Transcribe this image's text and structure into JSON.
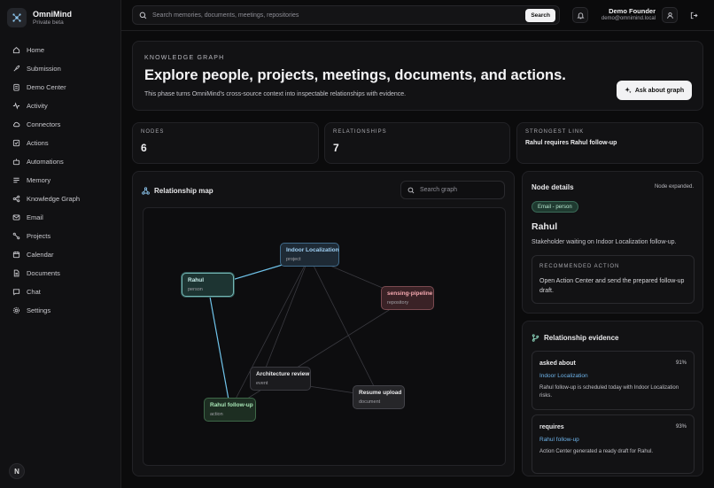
{
  "brand": {
    "name": "OmniMind",
    "subtitle": "Private beta",
    "avatar_initial": "N"
  },
  "nav": [
    {
      "label": "Home",
      "icon": "home-icon"
    },
    {
      "label": "Submission",
      "icon": "rocket-icon"
    },
    {
      "label": "Demo Center",
      "icon": "clipboard-icon"
    },
    {
      "label": "Activity",
      "icon": "activity-icon"
    },
    {
      "label": "Connectors",
      "icon": "cloud-icon"
    },
    {
      "label": "Actions",
      "icon": "check-square-icon"
    },
    {
      "label": "Automations",
      "icon": "bot-icon"
    },
    {
      "label": "Memory",
      "icon": "list-icon"
    },
    {
      "label": "Knowledge Graph",
      "icon": "graph-icon"
    },
    {
      "label": "Email",
      "icon": "mail-icon"
    },
    {
      "label": "Projects",
      "icon": "route-icon"
    },
    {
      "label": "Calendar",
      "icon": "calendar-icon"
    },
    {
      "label": "Documents",
      "icon": "document-icon"
    },
    {
      "label": "Chat",
      "icon": "chat-icon"
    },
    {
      "label": "Settings",
      "icon": "gear-icon"
    }
  ],
  "topbar": {
    "search_placeholder": "Search memories, documents, meetings, repositories",
    "search_button": "Search",
    "user_name": "Demo Founder",
    "user_email": "demo@omnimind.local"
  },
  "hero": {
    "eyebrow": "KNOWLEDGE GRAPH",
    "title": "Explore people, projects, meetings, documents, and actions.",
    "description": "This phase turns OmniMind's cross-source context into inspectable relationships with evidence.",
    "button": "Ask about graph"
  },
  "stats": [
    {
      "label": "NODES",
      "value": "6"
    },
    {
      "label": "RELATIONSHIPS",
      "value": "7"
    },
    {
      "label": "STRONGEST LINK",
      "value": "Rahul requires Rahul follow-up"
    }
  ],
  "map": {
    "title": "Relationship map",
    "search_placeholder": "Search graph",
    "nodes": [
      {
        "id": "indoor",
        "label": "Indoor Localization",
        "type": "project",
        "kind": "project"
      },
      {
        "id": "rahul",
        "label": "Rahul",
        "type": "person",
        "kind": "person"
      },
      {
        "id": "sensing",
        "label": "sensing-pipeline",
        "type": "repository",
        "kind": "repo"
      },
      {
        "id": "arch",
        "label": "Architecture review",
        "type": "event",
        "kind": "event"
      },
      {
        "id": "resume",
        "label": "Resume upload",
        "type": "document",
        "kind": "document"
      },
      {
        "id": "followup",
        "label": "Rahul follow-up",
        "type": "action",
        "kind": "action"
      }
    ]
  },
  "details": {
    "title": "Node details",
    "status": "Node expanded.",
    "badge": "Email - person",
    "name": "Rahul",
    "description": "Stakeholder waiting on Indoor Localization follow-up.",
    "rec_label": "RECOMMENDED ACTION",
    "rec_text": "Open Action Center and send the prepared follow-up draft."
  },
  "evidence": {
    "title": "Relationship evidence",
    "items": [
      {
        "relation": "asked about",
        "percent": "91%",
        "target": "Indoor Localization",
        "description": "Rahul follow-up is scheduled today with Indoor Localization risks."
      },
      {
        "relation": "requires",
        "percent": "93%",
        "target": "Rahul follow-up",
        "description": "Action Center generated a ready draft for Rahul."
      }
    ]
  },
  "colors": {
    "accent_link": "#6db3ea",
    "person": "#74b6b4",
    "repository": "#f5a8b0",
    "action": "#a8e6b6",
    "project": "#9fd0f4"
  }
}
